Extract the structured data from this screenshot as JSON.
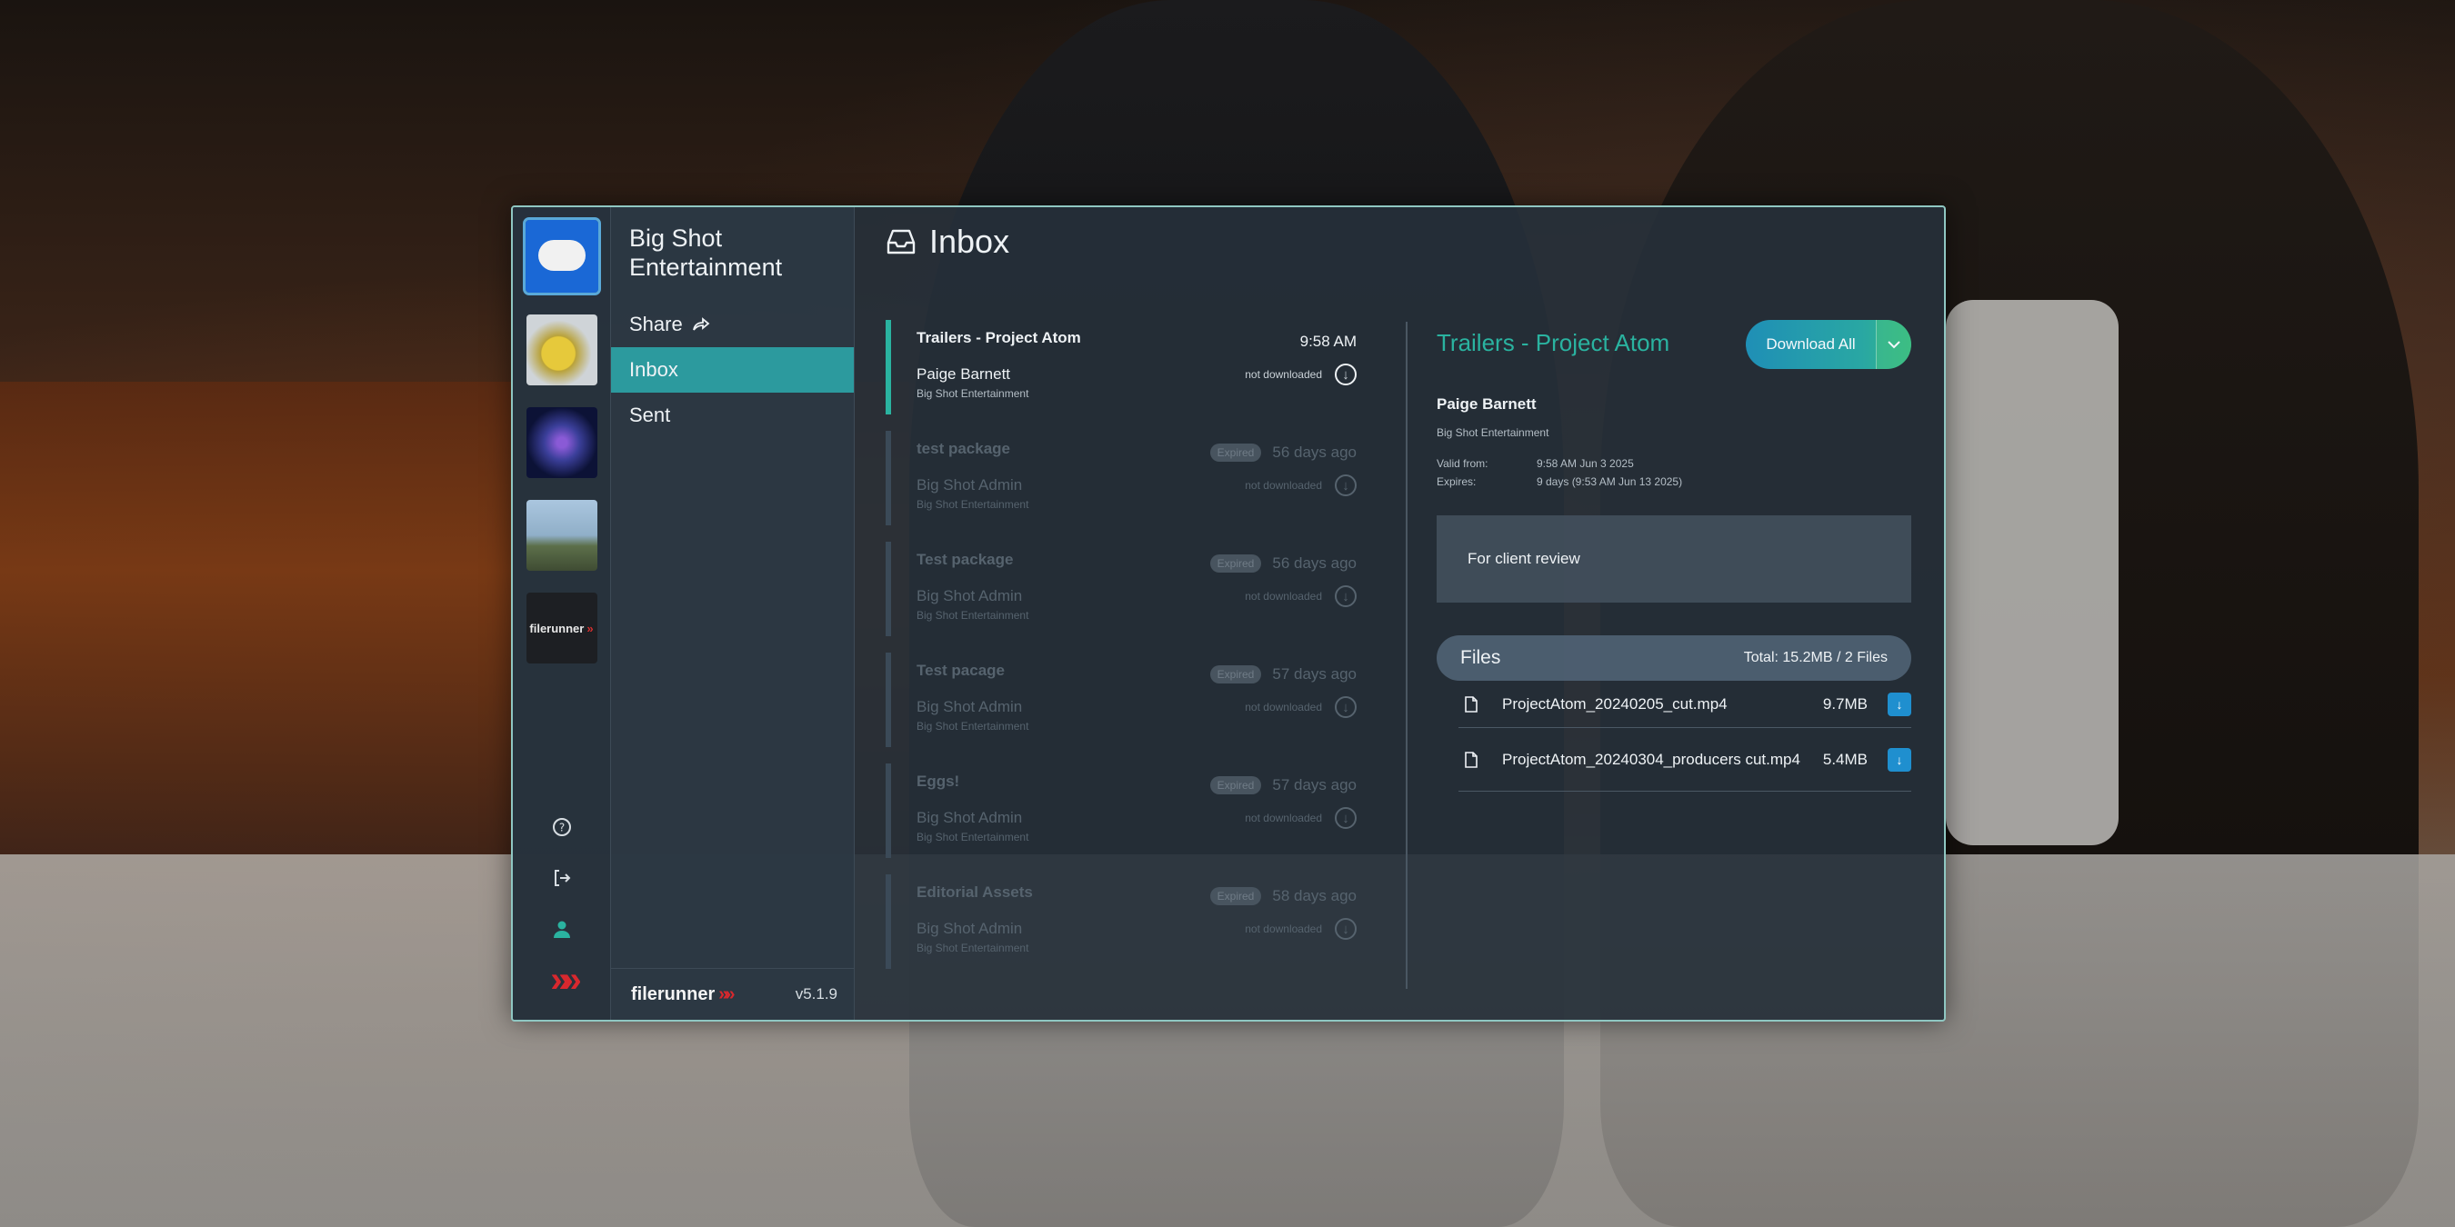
{
  "org": {
    "name": "Big Shot Entertainment"
  },
  "nav": {
    "share": "Share",
    "inbox": "Inbox",
    "sent": "Sent"
  },
  "rail": {
    "thumbs": [
      "big-shot-logo",
      "emoji-thumbnail",
      "galaxy-thumbnail",
      "dog-thumbnail",
      "filerunner-thumbnail"
    ],
    "filerunner_thumb_label": "filerunner"
  },
  "footer": {
    "brand": "filerunner",
    "version": "v5.1.9"
  },
  "main": {
    "title": "Inbox"
  },
  "messages": [
    {
      "title": "Trailers - Project Atom",
      "sender": "Paige Barnett",
      "org": "Big Shot Entertainment",
      "time": "9:58 AM",
      "status": "not downloaded",
      "badge": ""
    },
    {
      "title": "test package",
      "sender": "Big Shot Admin",
      "org": "Big Shot Entertainment",
      "time": "56 days ago",
      "status": "not downloaded",
      "badge": "Expired"
    },
    {
      "title": "Test package",
      "sender": "Big Shot Admin",
      "org": "Big Shot Entertainment",
      "time": "56 days ago",
      "status": "not downloaded",
      "badge": "Expired"
    },
    {
      "title": "Test pacage",
      "sender": "Big Shot Admin",
      "org": "Big Shot Entertainment",
      "time": "57 days ago",
      "status": "not downloaded",
      "badge": "Expired"
    },
    {
      "title": "Eggs!",
      "sender": "Big Shot Admin",
      "org": "Big Shot Entertainment",
      "time": "57 days ago",
      "status": "not downloaded",
      "badge": "Expired"
    },
    {
      "title": "Editorial Assets",
      "sender": "Big Shot Admin",
      "org": "Big Shot Entertainment",
      "time": "58 days ago",
      "status": "not downloaded",
      "badge": "Expired"
    }
  ],
  "detail": {
    "title": "Trailers - Project Atom",
    "download_all": "Download All",
    "sender": "Paige Barnett",
    "org": "Big Shot Entertainment",
    "valid_from_label": "Valid from:",
    "valid_from": "9:58 AM Jun 3 2025",
    "expires_label": "Expires:",
    "expires": "9 days (9:53 AM Jun 13 2025)",
    "note": "For client review",
    "files_label": "Files",
    "files_total": "Total: 15.2MB / 2 Files",
    "files": [
      {
        "name": "ProjectAtom_20240205_cut.mp4",
        "size": "9.7MB"
      },
      {
        "name": "ProjectAtom_20240304_producers cut.mp4",
        "size": "5.4MB"
      }
    ]
  },
  "colors": {
    "accent": "#2ab3a0",
    "nav_active": "#2c9a9e",
    "download_blue": "#1f8fcf",
    "brand_red": "#d8282e"
  }
}
